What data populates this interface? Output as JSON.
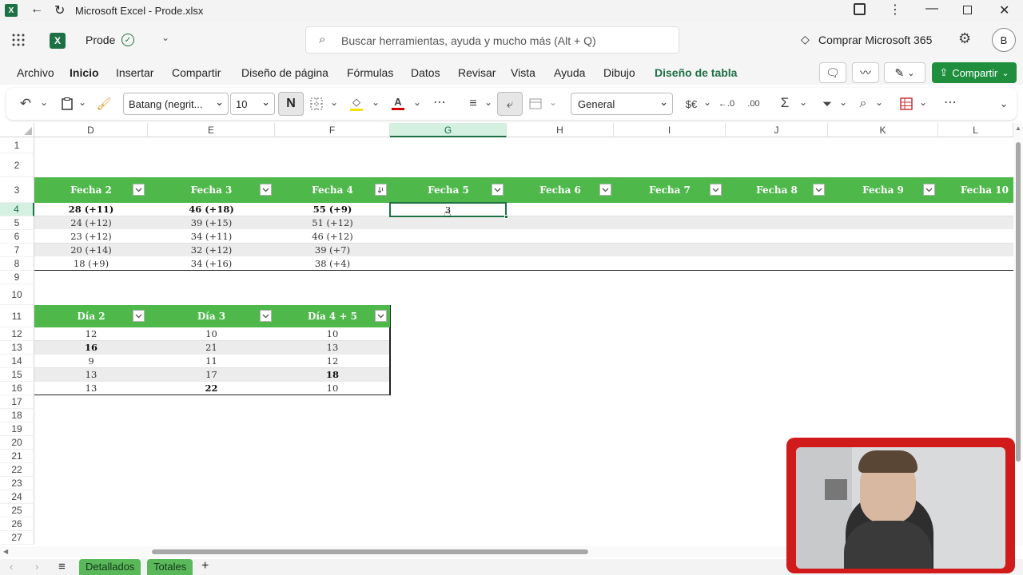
{
  "window": {
    "title": "Microsoft Excel - Prode.xlsx"
  },
  "appbar": {
    "file_name": "Prode",
    "search_placeholder": "Buscar herramientas, ayuda y mucho más (Alt + Q)",
    "buy_label": "Comprar Microsoft 365",
    "avatar_initial": "B"
  },
  "ribbon_tabs": [
    "Archivo",
    "Inicio",
    "Insertar",
    "Compartir",
    "Diseño de página",
    "Fórmulas",
    "Datos",
    "Revisar",
    "Vista",
    "Ayuda",
    "Dibujo",
    "Diseño de tabla"
  ],
  "share_label": "Compartir",
  "toolbar": {
    "font_name": "Batang (negrit...",
    "font_size": "10",
    "bold_label": "N",
    "number_format": "General",
    "currency": "$€"
  },
  "columns": [
    "D",
    "E",
    "F",
    "G",
    "H",
    "I",
    "J",
    "K",
    "L"
  ],
  "rows": [
    "1",
    "2",
    "3",
    "4",
    "5",
    "6",
    "7",
    "8",
    "9",
    "10",
    "11",
    "12",
    "13",
    "14",
    "15",
    "16",
    "17",
    "18",
    "19",
    "20",
    "21",
    "22",
    "23",
    "24",
    "25",
    "26",
    "27"
  ],
  "table1": {
    "headers": [
      "Fecha 2",
      "Fecha 3",
      "Fecha 4",
      "Fecha 5",
      "Fecha 6",
      "Fecha 7",
      "Fecha 8",
      "Fecha 9",
      "Fecha 10"
    ],
    "rows": [
      [
        "28 (+11)",
        "46 (+18)",
        "55 (+9)"
      ],
      [
        "24 (+12)",
        "39 (+15)",
        "51 (+12)"
      ],
      [
        "23 (+12)",
        "34 (+11)",
        "46 (+12)"
      ],
      [
        "20 (+14)",
        "32 (+12)",
        "39 (+7)"
      ],
      [
        "18 (+9)",
        "34 (+16)",
        "38 (+4)"
      ]
    ],
    "active_cell_value": "3"
  },
  "table2": {
    "headers": [
      "Día 2",
      "Día 3",
      "Día 4 + 5"
    ],
    "rows": [
      [
        "12",
        "10",
        "10"
      ],
      [
        "16",
        "21",
        "13"
      ],
      [
        "9",
        "11",
        "12"
      ],
      [
        "13",
        "17",
        "18"
      ],
      [
        "13",
        "22",
        "10"
      ]
    ]
  },
  "sheet_tabs": [
    "Detallados",
    "Totales"
  ],
  "colors": {
    "excel_green": "#1e7145",
    "header_green": "#4eb84b",
    "share_green": "#1f8f3e"
  }
}
